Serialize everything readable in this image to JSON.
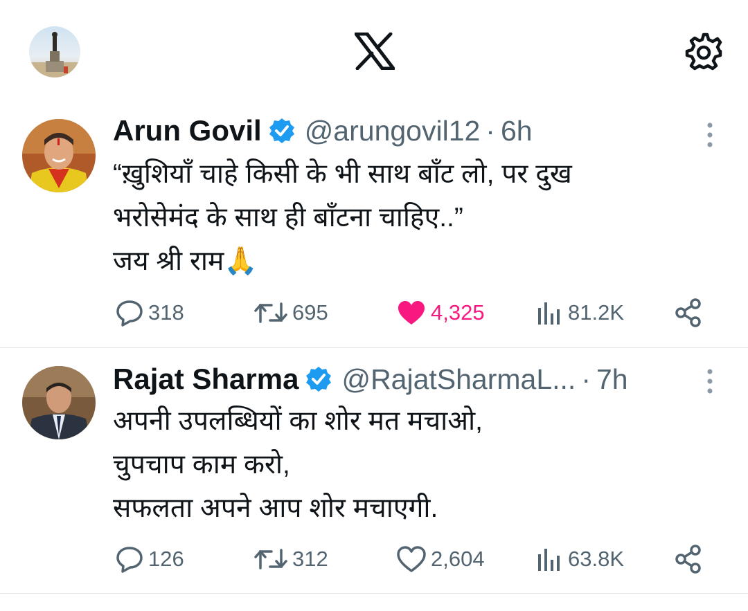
{
  "header": {
    "profile_icon": "profile-avatar-icon",
    "logo_icon": "x-logo-icon",
    "settings_icon": "gear-icon"
  },
  "tweets": [
    {
      "name": "Arun Govil",
      "handle": "@arungovil12",
      "separator": "·",
      "time": "6h",
      "lines": [
        "“ख़ुशियाँ चाहे किसी के भी साथ बाँट लो, पर दुख",
        "भरोसेमंद के साथ ही बाँटना चाहिए..”",
        "जय श्री राम🙏"
      ],
      "replies": "318",
      "retweets": "695",
      "likes": "4,325",
      "liked": true,
      "views": "81.2K"
    },
    {
      "name": "Rajat Sharma",
      "handle": "@RajatSharmaL...",
      "separator": "·",
      "time": "7h",
      "lines": [
        "अपनी उपलब्धियों का शोर मत मचाओ,",
        "चुपचाप काम करो,",
        "सफलता अपने आप शोर मचाएगी."
      ],
      "replies": "126",
      "retweets": "312",
      "likes": "2,604",
      "liked": false,
      "views": "63.8K"
    }
  ],
  "colors": {
    "text": "#0f1419",
    "muted": "#536471",
    "verified": "#1d9bf0",
    "like_active": "#f91880",
    "divider": "#e6e9eb"
  }
}
